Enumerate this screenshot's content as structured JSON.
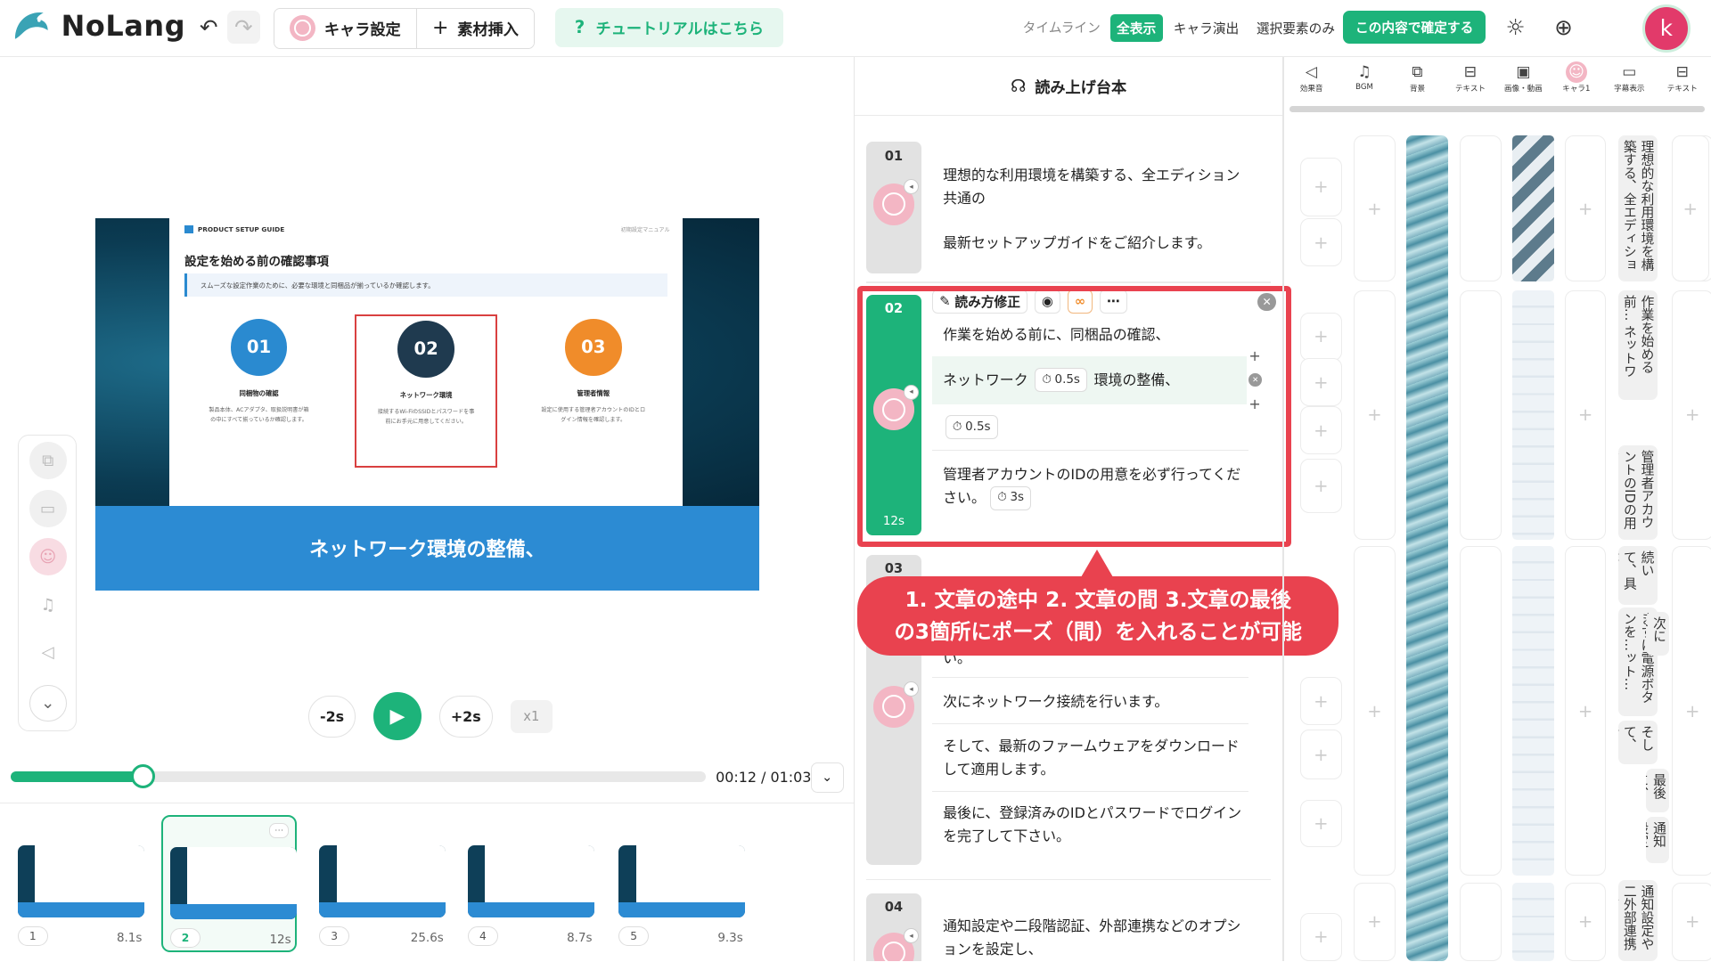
{
  "header": {
    "app_name": "NoLang",
    "chara_button": "キャラ設定",
    "material_button": "素材挿入",
    "tutorial": "チュートリアルはこちら",
    "timeline_label": "タイムライン",
    "filters": [
      "全表示",
      "キャラ演出",
      "選択要素のみ"
    ],
    "confirm_button": "この内容で確定する",
    "user_initial": "k",
    "colors": {
      "accent": "#1db37a",
      "highlight": "#e9424f"
    }
  },
  "slide": {
    "tag": "PRODUCT SETUP GUIDE",
    "corner": "初期設定マニュアル",
    "title": "設定を始める前の確認事項",
    "subtitle": "スムーズな設定作業のために、必要な環境と同梱品が揃っているか確認します。",
    "steps": [
      {
        "num": "01",
        "title": "同梱物の確認",
        "desc": "製品本体、ACアダプタ、取扱説明書が箱の中にすべて揃っているか確認します。",
        "color": "#2a8ad0"
      },
      {
        "num": "02",
        "title": "ネットワーク環境",
        "desc": "接続するWi-FiのSSIDとパスワードを事前にお手元に用意してください。",
        "color": "#1f3a4f"
      },
      {
        "num": "03",
        "title": "管理者情報",
        "desc": "設定に使用する管理者アカウントのIDとログイン情報を確認します。",
        "color": "#f08c2a"
      }
    ],
    "caption": "ネットワーク環境の整備、"
  },
  "player": {
    "back": "-2s",
    "forward": "+2s",
    "speed": "x1",
    "progress": 0.19,
    "timecode": "00:12 / 01:03"
  },
  "thumbnails": [
    {
      "num": "1",
      "dur": "8.1s"
    },
    {
      "num": "2",
      "dur": "12s",
      "active": true
    },
    {
      "num": "3",
      "dur": "25.6s"
    },
    {
      "num": "4",
      "dur": "8.7s"
    },
    {
      "num": "5",
      "dur": "9.3s"
    }
  ],
  "script": {
    "title": "読み上げ台本",
    "block01": {
      "num": "01",
      "lines": [
        "理想的な利用環境を構築する、全エディション共通の",
        "最新セットアップガイドをご紹介します。"
      ]
    },
    "block02": {
      "num": "02",
      "duration": "12s",
      "toolbar_label": "読み方修正",
      "line1": "作業を始める前に、同梱品の確認、",
      "line2a": "ネットワーク",
      "pause1": "0.5s",
      "line2b": "環境の整備、",
      "pause2": "0.5s",
      "line3": "管理者アカウントのIDの用意を必ず行ってください。",
      "pause3": "3s"
    },
    "block03": {
      "num": "03",
      "lines": [
        "い。",
        "次にネットワーク接続を行います。",
        "そして、最新のファームウェアをダウンロードして適用します。",
        "最後に、登録済みのIDとパスワードでログインを完了して下さい。"
      ]
    },
    "block04": {
      "num": "04",
      "lines": [
        "通知設定や二段階認証、外部連携などのオプションを設定し、"
      ]
    },
    "callout": [
      "1. 文章の途中 2. 文章の間 3.文章の最後",
      "の3箇所にポーズ（間）を入れることが可能"
    ]
  },
  "timeline": {
    "icons": [
      {
        "label": "効果音",
        "icon": "megaphone-icon"
      },
      {
        "label": "BGM",
        "icon": "music-icon"
      },
      {
        "label": "背景",
        "icon": "background-icon"
      },
      {
        "label": "テキスト",
        "icon": "text-icon"
      },
      {
        "label": "画像・動画",
        "icon": "image-icon"
      },
      {
        "label": "キャラ1",
        "icon": "chara-icon"
      },
      {
        "label": "字幕表示",
        "icon": "subtitle-icon"
      },
      {
        "label": "テキスト",
        "icon": "text-icon"
      }
    ],
    "texts": [
      "理想的な利用環境を構築する、全エディション…",
      "作業を始める前… ネットワー…",
      "管理者アカウントのIDの用意…",
      "続いて、具体的…",
      "まずは電源ボタンを…ット…",
      "次にネ…",
      "そして、新のファー…",
      "最後に、登録済みのIDと…",
      "通知設定や二外部連携など…"
    ]
  }
}
